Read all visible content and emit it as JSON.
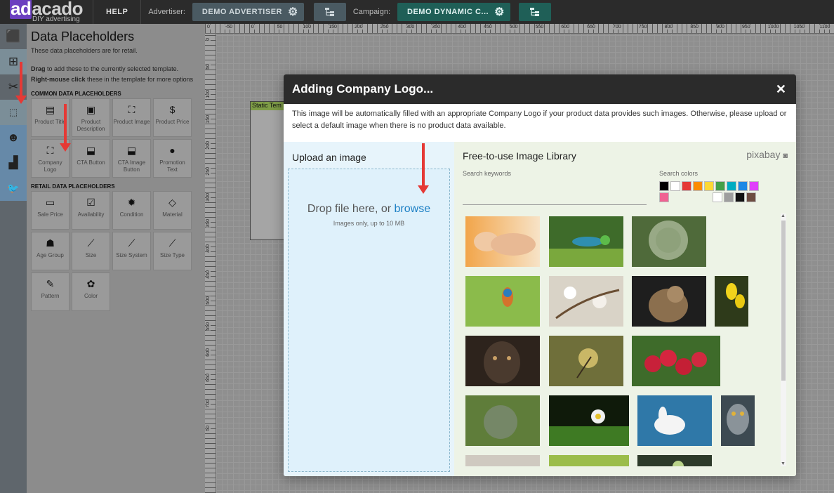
{
  "topbar": {
    "logo_ad": "ad",
    "logo_rest": "acado",
    "logo_tagline": "DIY advertising",
    "help": "HELP",
    "advertiser_label": "Advertiser:",
    "advertiser_value": "DEMO ADVERTISER",
    "campaign_label": "Campaign:",
    "campaign_value": "DEMO DYNAMIC C..."
  },
  "panel": {
    "title": "Data Placeholders",
    "subtitle": "These data placeholders are for retail.",
    "inst_drag": "Drag",
    "inst_drag_rest": " to add these to the currently selected template.",
    "inst_right": "Right-mouse click",
    "inst_right_rest": " these in the template for more options",
    "common_header": "COMMON DATA PLACEHOLDERS",
    "common": [
      {
        "label": "Product Title",
        "icon": "calculator-icon"
      },
      {
        "label": "Product Description",
        "icon": "window-icon"
      },
      {
        "label": "Product Image",
        "icon": "image-frame-icon"
      },
      {
        "label": "Product Price",
        "icon": "dollar-icon"
      },
      {
        "label": "Company Logo",
        "icon": "logo-frame-icon"
      },
      {
        "label": "CTA Button",
        "icon": "cursor-button-icon"
      },
      {
        "label": "CTA Image Button",
        "icon": "cursor-image-icon"
      },
      {
        "label": "Promotion Text",
        "icon": "speech-bubble-icon"
      }
    ],
    "retail_header": "RETAIL DATA PLACEHOLDERS",
    "retail": [
      {
        "label": "Sale Price",
        "icon": "money-icon"
      },
      {
        "label": "Availability",
        "icon": "clipboard-check-icon"
      },
      {
        "label": "Condition",
        "icon": "alert-badge-icon"
      },
      {
        "label": "Material",
        "icon": "diamond-icon"
      },
      {
        "label": "Age Group",
        "icon": "group-icon"
      },
      {
        "label": "Size",
        "icon": "ruler-icon"
      },
      {
        "label": "Size System",
        "icon": "ruler-icon"
      },
      {
        "label": "Size Type",
        "icon": "ruler-icon"
      },
      {
        "label": "Pattern",
        "icon": "brush-icon"
      },
      {
        "label": "Color",
        "icon": "palette-icon"
      }
    ]
  },
  "ruler": {
    "h": [
      "0",
      "-50",
      "0",
      "50",
      "100",
      "150",
      "200",
      "250",
      "300",
      "350",
      "400",
      "450",
      "500",
      "550",
      "600",
      "650",
      "700",
      "750",
      "800",
      "850",
      "900",
      "950",
      "1000",
      "1050",
      "1100"
    ],
    "v": [
      "0",
      "50",
      "100",
      "150",
      "200",
      "250",
      "300",
      "350",
      "400",
      "450",
      "500",
      "550",
      "600",
      "650",
      "700",
      "50"
    ]
  },
  "template": {
    "label": "Static Tem"
  },
  "modal": {
    "title": "Adding Company Logo...",
    "close": "✕",
    "description": "This image will be automatically filled with an appropriate Company Logo if your product data provides such images. Otherwise, please upload or select a default image when there is no product data available.",
    "upload": {
      "title": "Upload an image",
      "drop_text": "Drop file here, or ",
      "browse": "browse",
      "hint": "Images only, up to 10 MB"
    },
    "library": {
      "title": "Free-to-use Image Library",
      "provider": "pixabay",
      "search_label": "Search keywords",
      "search_value": "",
      "colors_label": "Search colors",
      "colors": [
        "#000000",
        "#ffffff",
        "#e53935",
        "#fb8c00",
        "#fdd835",
        "#43a047",
        "#00acc1",
        "#1e88e5",
        "#e040fb",
        "#f06292",
        "#ffffff",
        "#9e9e9e",
        "#111111",
        "#6d4c41"
      ]
    }
  }
}
